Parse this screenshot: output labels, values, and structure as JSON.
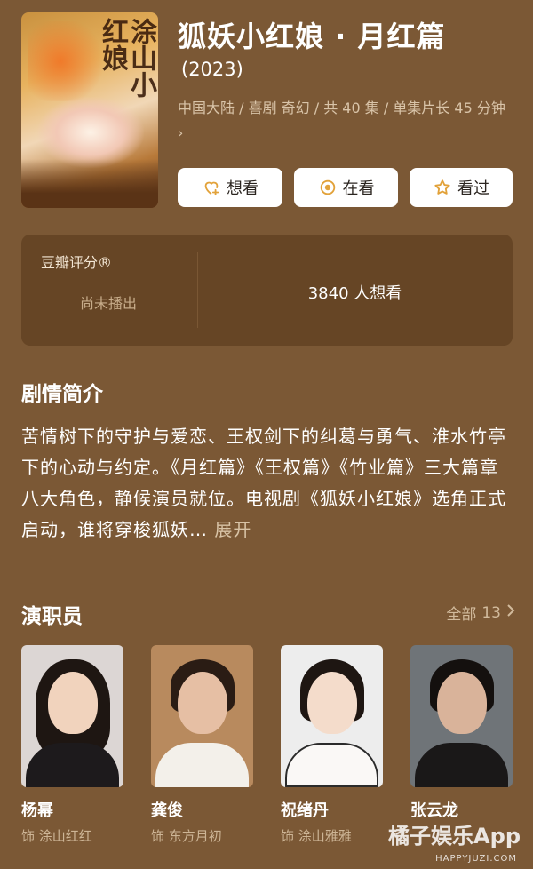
{
  "header": {
    "title": "狐妖小红娘 · 月红篇",
    "year": "(2023)",
    "meta": "中国大陆 / 喜剧 奇幻 / 共 40 集 / 单集片长 45 分钟",
    "meta_chevron": "›",
    "poster_title_art": "涂山小红娘"
  },
  "actions": {
    "want_label": "想看",
    "watching_label": "在看",
    "watched_label": "看过"
  },
  "rating": {
    "label": "豆瓣评分®",
    "status": "尚未播出",
    "wish_count": "3840 人想看"
  },
  "synopsis": {
    "title": "剧情简介",
    "text": "苦情树下的守护与爱恋、王权剑下的纠葛与勇气、淮水竹亭下的心动与约定。《月红篇》《王权篇》《竹业篇》三大篇章八大角色，静候演员就位。电视剧《狐妖小红娘》选角正式启动，谁将穿梭狐妖…",
    "expand_label": "展开"
  },
  "cast": {
    "title": "演职员",
    "all_label": "全部",
    "all_count": "13",
    "members": [
      {
        "name": "杨幂",
        "role": "饰 涂山红红"
      },
      {
        "name": "龚俊",
        "role": "饰 东方月初"
      },
      {
        "name": "祝绪丹",
        "role": "饰 涂山雅雅"
      },
      {
        "name": "张云龙",
        "role": ""
      }
    ]
  },
  "watermark": {
    "brand": "橘子娱乐App",
    "url": "HAPPYJUZI.COM"
  },
  "colors": {
    "background": "#7b5835",
    "card": "#664525",
    "accent": "#e2a23a"
  }
}
